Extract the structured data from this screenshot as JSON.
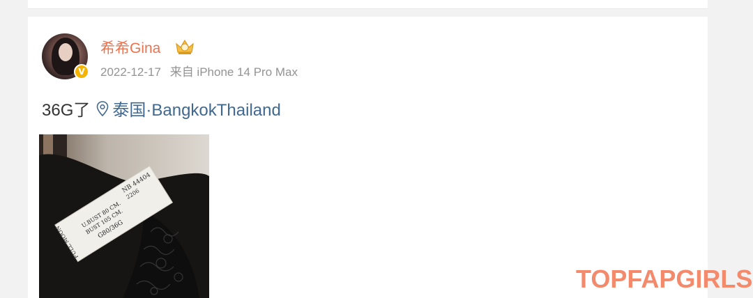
{
  "post": {
    "username": "希希Gina",
    "date": "2022-12-17",
    "source": "来自 iPhone 14 Pro Max",
    "text": "36G了",
    "location": "泰国·BangkokThailand"
  },
  "photo_label": {
    "lines": [
      "NB 44404",
      "2206",
      "U.BUST 80 CM.",
      "BUST 105 CM.",
      "G80/36G",
      "FULL MOON"
    ]
  },
  "watermark": "TOPFAPGIRLS",
  "colors": {
    "username": "#eb7350",
    "meta": "#939393",
    "location": "#41688f",
    "watermark": "#f48a6c",
    "verified_badge": "#f5b400"
  },
  "icons": {
    "verified": "verified-badge-icon",
    "member": "crown-icon",
    "location": "location-pin-icon"
  }
}
